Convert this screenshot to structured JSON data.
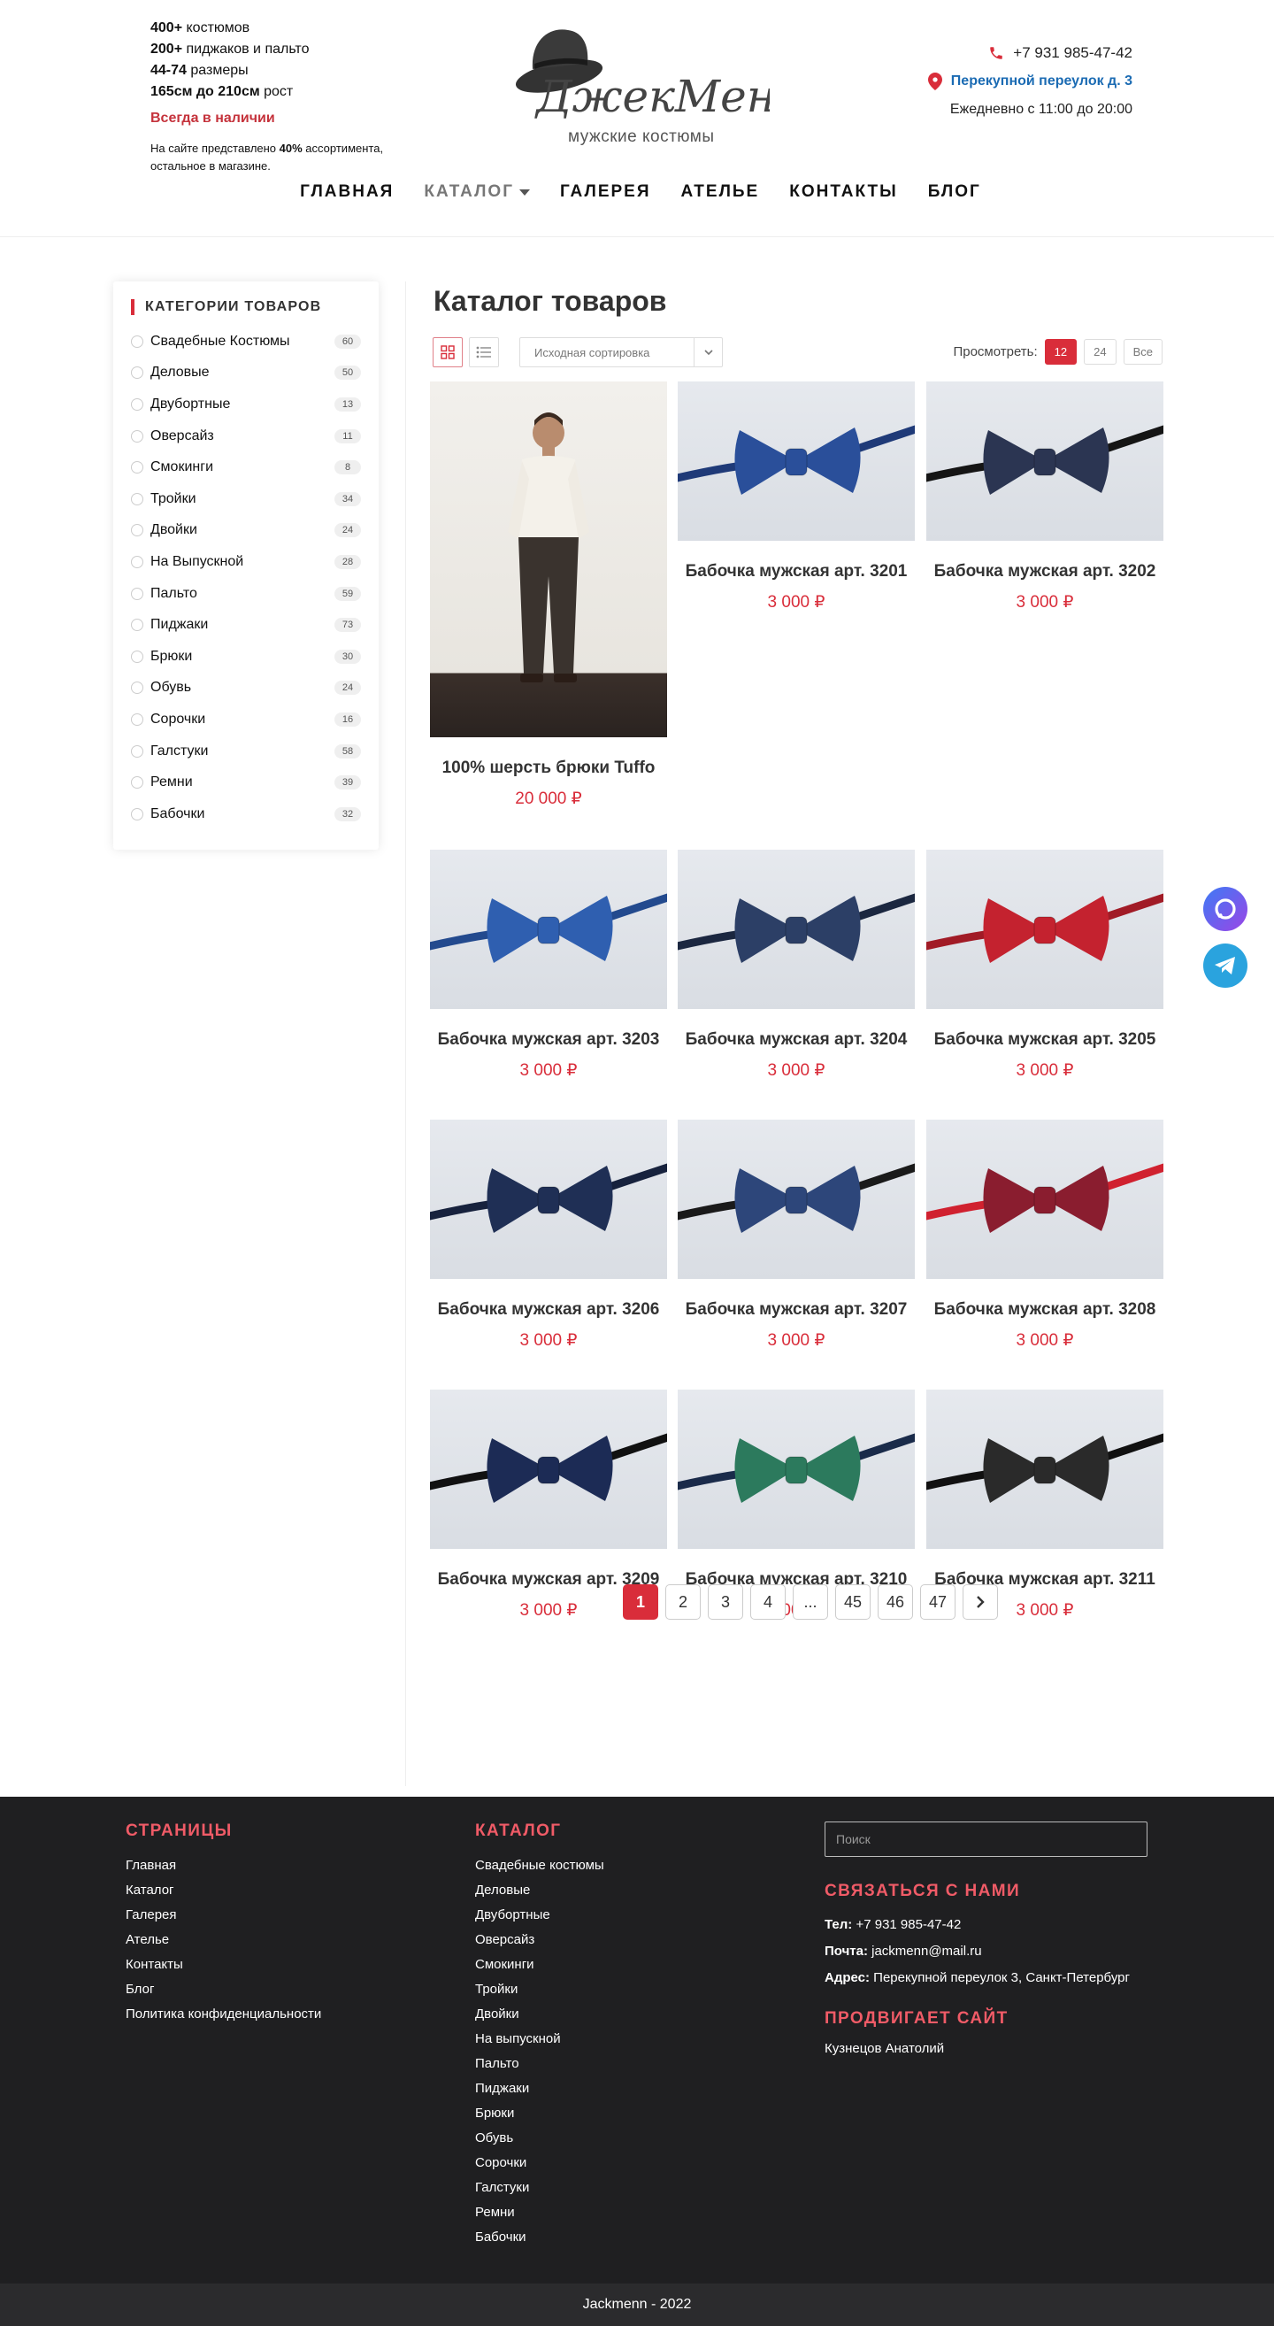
{
  "header": {
    "promo": [
      {
        "bold": "400+",
        "text": " костюмов"
      },
      {
        "bold": "200+",
        "text": " пиджаков и пальто"
      },
      {
        "bold": "44-74",
        "text": " размеры"
      },
      {
        "bold": "165см до 210см",
        "text": " рост"
      }
    ],
    "availability": "Всегда в наличии",
    "note_prefix": "На сайте представлено ",
    "note_bold": "40%",
    "note_suffix": " ассортимента,",
    "note_line2": "остальное в магазине.",
    "logo_text": "ДжекМенн",
    "logo_tagline": "мужские костюмы",
    "phone": "+7 931 985-47-42",
    "address": "Перекупной переулок д. 3",
    "hours": "Ежедневно с 11:00 до 20:00"
  },
  "nav": {
    "items": [
      "ГЛАВНАЯ",
      "КАТАЛОГ",
      "ГАЛЕРЕЯ",
      "АТЕЛЬЕ",
      "КОНТАКТЫ",
      "БЛОГ"
    ],
    "active": "КАТАЛОГ"
  },
  "sidebar": {
    "title": "КАТЕГОРИИ ТОВАРОВ",
    "categories": [
      {
        "label": "Свадебные Костюмы",
        "count": "60"
      },
      {
        "label": "Деловые",
        "count": "50"
      },
      {
        "label": "Двубортные",
        "count": "13"
      },
      {
        "label": "Оверсайз",
        "count": "11"
      },
      {
        "label": "Смокинги",
        "count": "8"
      },
      {
        "label": "Тройки",
        "count": "34"
      },
      {
        "label": "Двойки",
        "count": "24"
      },
      {
        "label": "На Выпускной",
        "count": "28"
      },
      {
        "label": "Пальто",
        "count": "59"
      },
      {
        "label": "Пиджаки",
        "count": "73"
      },
      {
        "label": "Брюки",
        "count": "30"
      },
      {
        "label": "Обувь",
        "count": "24"
      },
      {
        "label": "Сорочки",
        "count": "16"
      },
      {
        "label": "Галстуки",
        "count": "58"
      },
      {
        "label": "Ремни",
        "count": "39"
      },
      {
        "label": "Бабочки",
        "count": "32"
      }
    ]
  },
  "catalog": {
    "title": "Каталог товаров",
    "sort_placeholder": "Исходная сортировка",
    "show_label": "Просмотреть:",
    "per_page": [
      "12",
      "24",
      "Все"
    ],
    "per_page_active": "12",
    "products": [
      {
        "name": "100% шерсть брюки Tuffo",
        "price": "20 000 ₽",
        "tie": "",
        "band": ""
      },
      {
        "name": "Бабочка мужская арт. 3201",
        "price": "3 000 ₽",
        "tie": "#2a4f9a",
        "band": "#1f3a78"
      },
      {
        "name": "Бабочка мужская арт. 3202",
        "price": "3 000 ₽",
        "tie": "#2b3552",
        "band": "#151515"
      },
      {
        "name": "Бабочка мужская арт. 3203",
        "price": "3 000 ₽",
        "tie": "#2f5fb0",
        "band": "#234a8e"
      },
      {
        "name": "Бабочка мужская арт. 3204",
        "price": "3 000 ₽",
        "tie": "#2c3f66",
        "band": "#1b2740"
      },
      {
        "name": "Бабочка мужская арт. 3205",
        "price": "3 000 ₽",
        "tie": "#c4222f",
        "band": "#a11b26"
      },
      {
        "name": "Бабочка мужская арт. 3206",
        "price": "3 000 ₽",
        "tie": "#1f2f55",
        "band": "#17223d"
      },
      {
        "name": "Бабочка мужская арт. 3207",
        "price": "3 000 ₽",
        "tie": "#2d467a",
        "band": "#1a1a1a"
      },
      {
        "name": "Бабочка мужская арт. 3208",
        "price": "3 000 ₽",
        "tie": "#8a1d2f",
        "band": "#d0212f"
      },
      {
        "name": "Бабочка мужская арт. 3209",
        "price": "3 000 ₽",
        "tie": "#1c2b55",
        "band": "#111"
      },
      {
        "name": "Бабочка мужская арт. 3210",
        "price": "3 000 ₽",
        "tie": "#2c7a5d",
        "band": "#1a2b4a"
      },
      {
        "name": "Бабочка мужская арт. 3211",
        "price": "3 000 ₽",
        "tie": "#2a2a2a",
        "band": "#111"
      }
    ],
    "pages": [
      "1",
      "2",
      "3",
      "4",
      "...",
      "45",
      "46",
      "47"
    ],
    "page_active": "1"
  },
  "footer": {
    "pages_title": "СТРАНИЦЫ",
    "pages": [
      "Главная",
      "Каталог",
      "Галерея",
      "Ателье",
      "Контакты",
      "Блог",
      "Политика конфиденциальности"
    ],
    "catalog_title": "КАТАЛОГ",
    "catalog": [
      "Свадебные костюмы",
      "Деловые",
      "Двубортные",
      "Оверсайз",
      "Смокинги",
      "Тройки",
      "Двойки",
      "На выпускной",
      "Пальто",
      "Пиджаки",
      "Брюки",
      "Обувь",
      "Сорочки",
      "Галстуки",
      "Ремни",
      "Бабочки"
    ],
    "search_placeholder": "Поиск",
    "contact_title": "СВЯЗАТЬСЯ С НАМИ",
    "tel_label": "Тел:",
    "tel": " +7 931 985-47-42",
    "mail_label": "Почта:",
    "mail": " jackmenn@mail.ru",
    "addr_label": "Адрес:",
    "addr": " Перекупной переулок 3, Санкт-Петербург",
    "promo_title": "ПРОДВИГАЕТ САЙТ",
    "promo_name": "Кузнецов Анатолий",
    "copyright": "Jackmenn - 2022"
  },
  "colors": {
    "accent": "#d92d3a",
    "link": "#1b6bb3",
    "footer_bg": "#1f1f21",
    "footer_heading": "#f05b67"
  }
}
